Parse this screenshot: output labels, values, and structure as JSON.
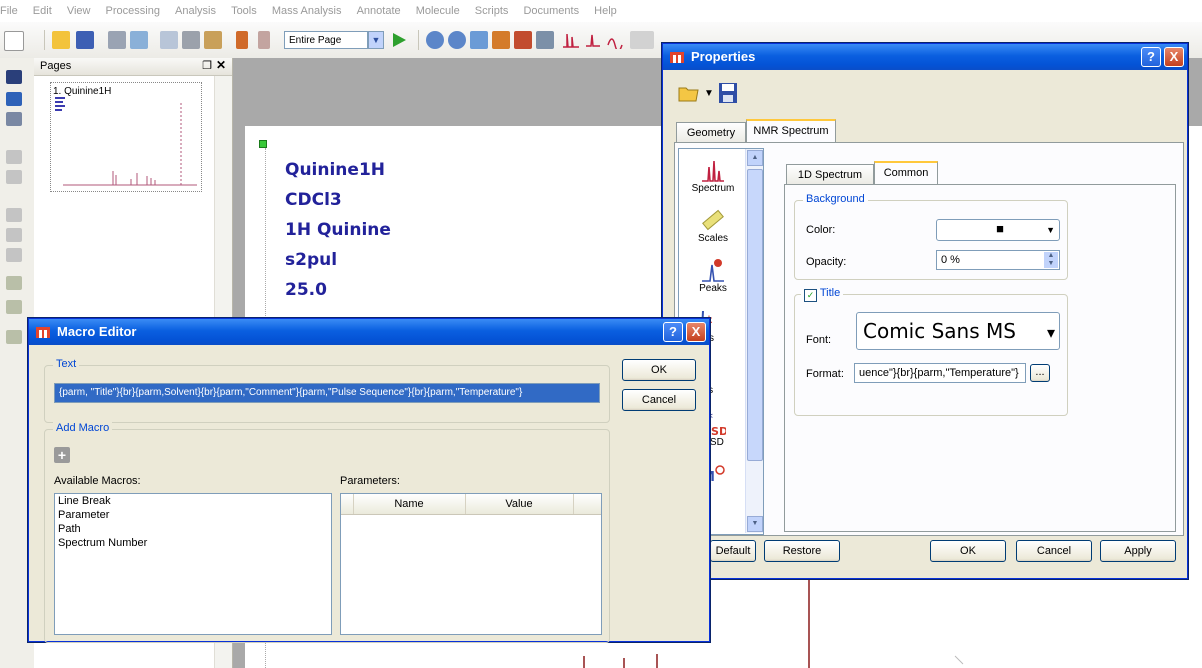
{
  "menubar": [
    "File",
    "Edit",
    "View",
    "Processing",
    "Analysis",
    "Tools",
    "Mass Analysis",
    "Annotate",
    "Molecule",
    "Scripts",
    "Documents",
    "Help"
  ],
  "toolbar": {
    "zoom_value": "Entire Page"
  },
  "pages_panel": {
    "title": "Pages",
    "pin": "❐",
    "close": "✕",
    "page_label": "1. Quinine1H"
  },
  "spectrum_page": {
    "lines": [
      "Quinine1H",
      "CDCl3",
      "1H Quinine",
      "s2pul",
      "25.0"
    ]
  },
  "properties": {
    "title": "Properties",
    "help": "?",
    "close": "X",
    "tabs": [
      "Geometry",
      "NMR Spectrum"
    ],
    "categories": [
      "Spectrum",
      "Scales",
      "Peaks",
      "tegrals",
      "ltiplets",
      "GSD"
    ],
    "subtabs": [
      "1D Spectrum",
      "Common"
    ],
    "background_group": "Background",
    "color_label": "Color:",
    "color_value": "■",
    "opacity_label": "Opacity:",
    "opacity_value": "0 %",
    "title_group": "Title",
    "title_checkbox": "✓",
    "font_label": "Font:",
    "font_value": "Comic Sans MS",
    "format_label": "Format:",
    "format_value": "uence\"}{br}{parm,\"Temperature\"}",
    "browse": "...",
    "buttons": {
      "default": "Default",
      "restore": "Restore",
      "ok": "OK",
      "cancel": "Cancel",
      "apply": "Apply"
    }
  },
  "macro_editor": {
    "title": "Macro Editor",
    "help": "?",
    "close": "X",
    "text_group": "Text",
    "text_value": "{parm, \"Title\"}{br}{parm,Solvent}{br}{parm,\"Comment\"}{parm,\"Pulse Sequence\"}{br}{parm,\"Temperature\"}",
    "ok": "OK",
    "cancel": "Cancel",
    "add_macro_group": "Add Macro",
    "add_icon": "+",
    "available_label": "Available Macros:",
    "macros": [
      "Line Break",
      "Parameter",
      "Path",
      "Spectrum Number"
    ],
    "parameters_label": "Parameters:",
    "param_columns": [
      "Name",
      "Value"
    ]
  }
}
